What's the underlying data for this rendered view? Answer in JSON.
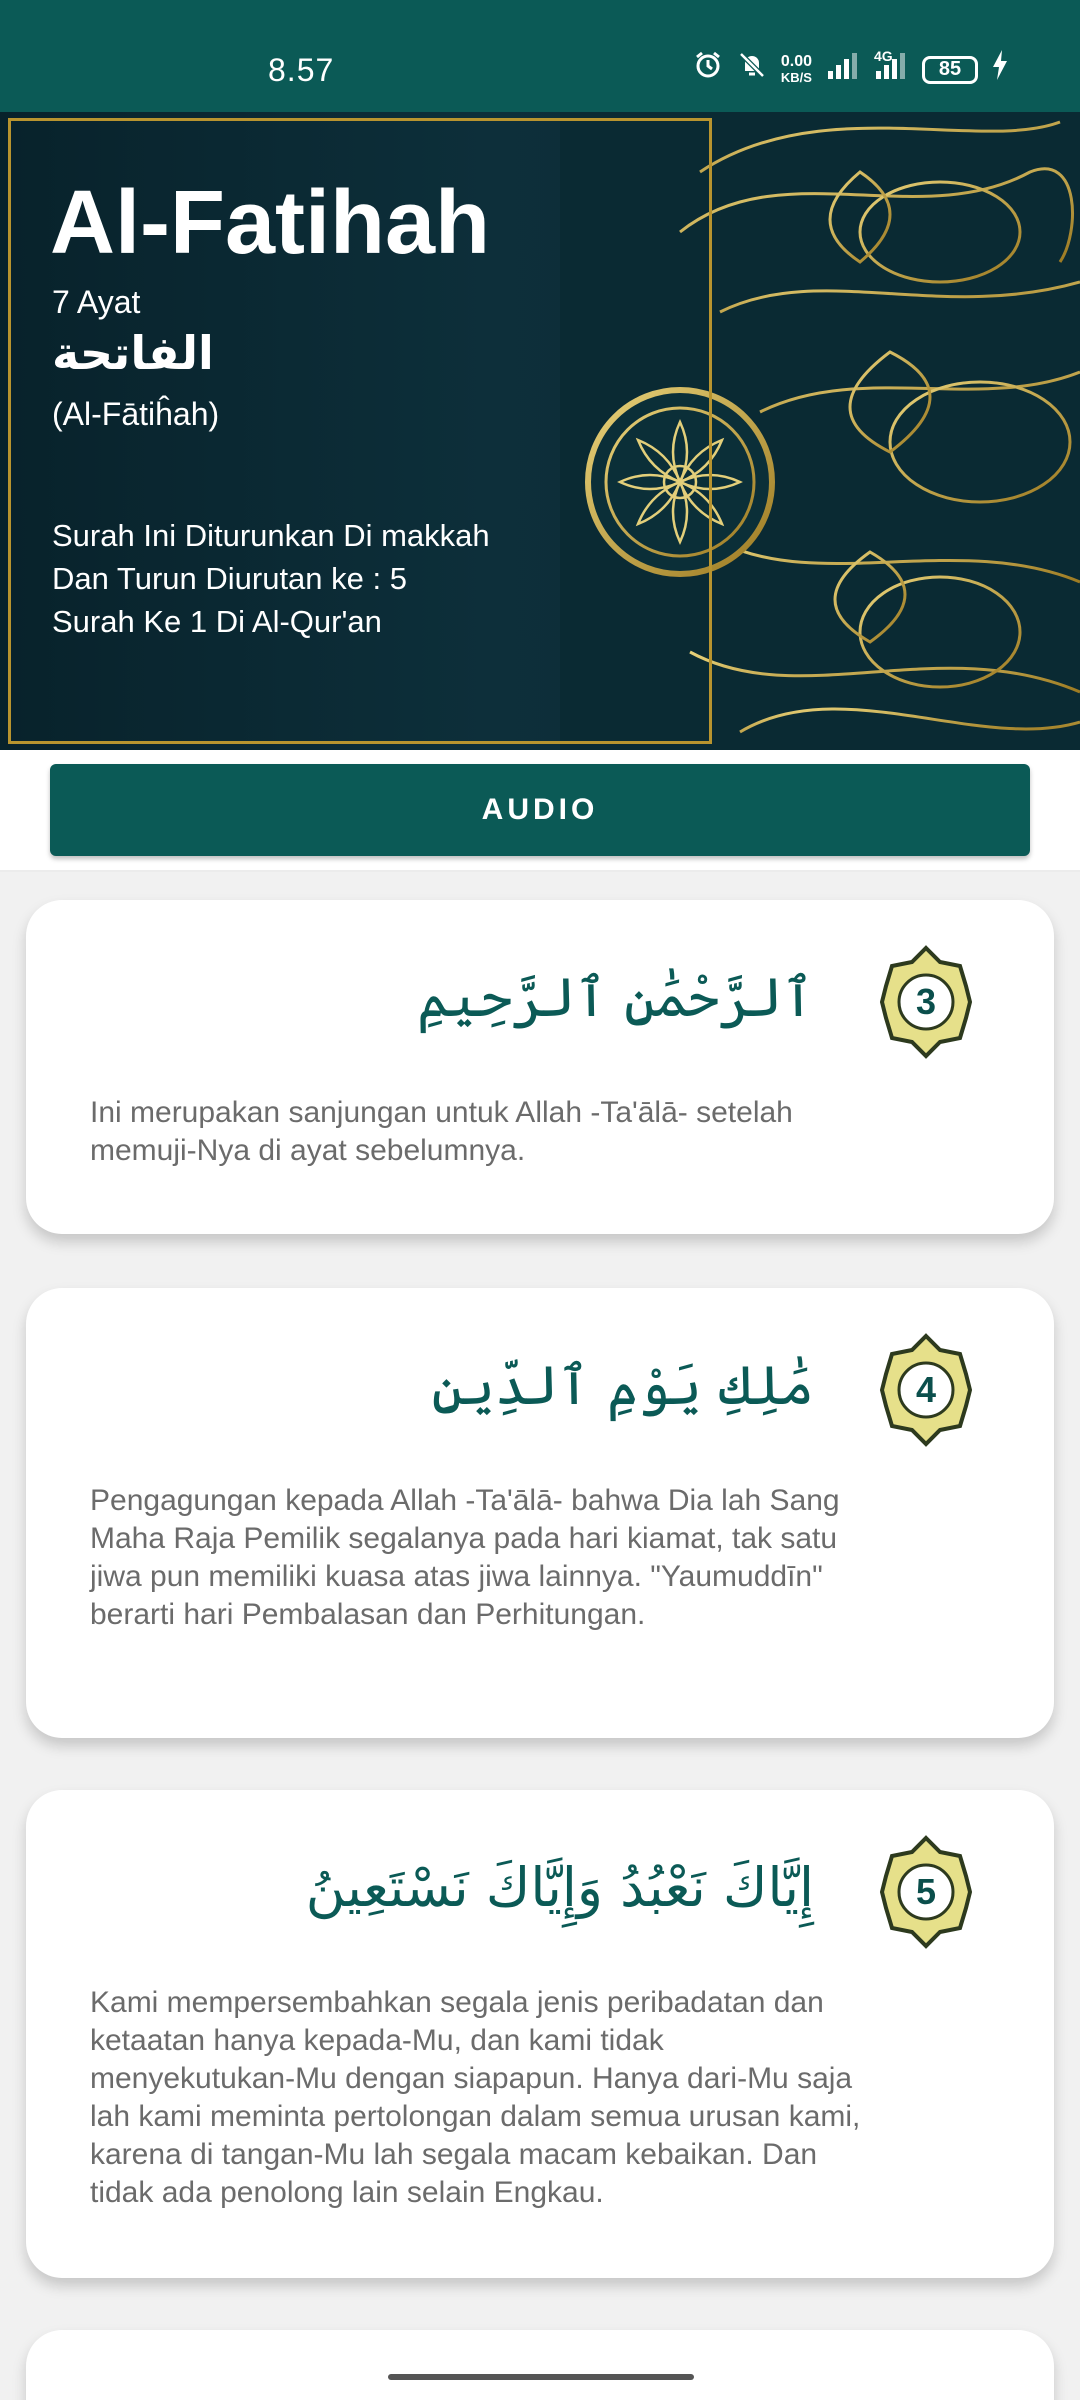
{
  "status_bar": {
    "time": "8.57",
    "net_speed_top": "0.00",
    "net_speed_bottom": "KB/S",
    "network_type": "4G",
    "battery": "85"
  },
  "header": {
    "title": "Al-Fatihah",
    "ayat_count": "7 Ayat",
    "arabic_name": "الفاتحة",
    "latin_name": "(Al-Fātiĥah)",
    "info_lines": [
      "Surah Ini Diturunkan Di makkah",
      "Dan Turun Diurutan ke : 5",
      "Surah Ke 1 Di Al-Qur'an"
    ]
  },
  "audio_button": {
    "label": "AUDIO"
  },
  "verses": [
    {
      "number": "3",
      "arabic": "ٱلرَّحْمَٰنِ ٱلرَّحِيمِ",
      "translation": "Ini merupakan sanjungan untuk Allah -Ta'ālā- setelah memuji-Nya di ayat sebelumnya."
    },
    {
      "number": "4",
      "arabic": "مَٰلِكِ يَوْمِ ٱلدِّينِ",
      "translation": "Pengagungan kepada Allah -Ta'ālā- bahwa Dia lah Sang Maha Raja Pemilik segalanya pada hari kiamat, tak satu jiwa pun memiliki kuasa atas jiwa lainnya. \"Yaumuddīn\" berarti hari Pembalasan dan Perhitungan."
    },
    {
      "number": "5",
      "arabic": "إِيَّاكَ نَعْبُدُ وَإِيَّاكَ نَسْتَعِينُ",
      "translation": "Kami mempersembahkan segala jenis peribadatan dan ketaatan hanya kepada-Mu, dan kami tidak menyekutukan-Mu dengan siapapun. Hanya dari-Mu saja lah kami meminta pertolongan dalam semua urusan kami, karena di tangan-Mu lah segala macam kebaikan. Dan tidak ada penolong lain selain Engkau."
    }
  ],
  "colors": {
    "primary": "#0b5a56",
    "banner_bg": "#0d2f3a",
    "gold": "#b8942f",
    "badge_fill": "#e6e08a"
  }
}
